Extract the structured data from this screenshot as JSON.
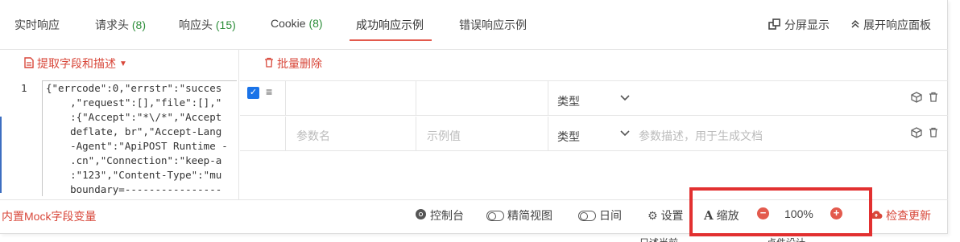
{
  "tabs": [
    {
      "label": "实时响应"
    },
    {
      "label": "请求头",
      "count": "(8)"
    },
    {
      "label": "响应头",
      "count": "(15)"
    },
    {
      "label": "Cookie",
      "count": "(8)"
    },
    {
      "label": "成功响应示例",
      "active": true
    },
    {
      "label": "错误响应示例"
    }
  ],
  "tab_tools": {
    "split": "分屏显示",
    "expand": "展开响应面板"
  },
  "left": {
    "extract_label": "提取字段和描述",
    "line_number": "1",
    "code_lines": [
      "{\"errcode\":0,\"errstr\":\"succes",
      "    ,\"request\":[],\"file\":[],\"",
      "    :{\"Accept\":\"*\\/*\",\"Accept",
      "    deflate, br\",\"Accept-Lang",
      "    -Agent\":\"ApiPOST Runtime -",
      "    .cn\",\"Connection\":\"keep-a",
      "    :\"123\",\"Content-Type\":\"mu",
      "    boundary=----------------"
    ]
  },
  "right": {
    "batch_delete_label": "批量删除",
    "rows": [
      {
        "checked": true,
        "name_placeholder": "",
        "example_placeholder": "",
        "type_label": "类型",
        "desc_placeholder": ""
      },
      {
        "checked": false,
        "name_placeholder": "参数名",
        "example_placeholder": "示例值",
        "type_label": "类型",
        "desc_placeholder": "参数描述，用于生成文档"
      }
    ]
  },
  "bottom": {
    "mock_label": "内置Mock字段变量",
    "console": "控制台",
    "compact_view": "精简视图",
    "night": "日间",
    "settings": "设置",
    "zoom_label": "缩放",
    "zoom_value": "100%",
    "check_update": "检查更新"
  },
  "peek": {
    "left": "只述当前",
    "right": "点件设计"
  },
  "colors": {
    "accent_red": "#d8473a",
    "highlight_red": "#e23030",
    "active_underline": "#e35a4d",
    "count_green": "#2f8f3c",
    "checkbox_blue": "#1a73e8"
  }
}
